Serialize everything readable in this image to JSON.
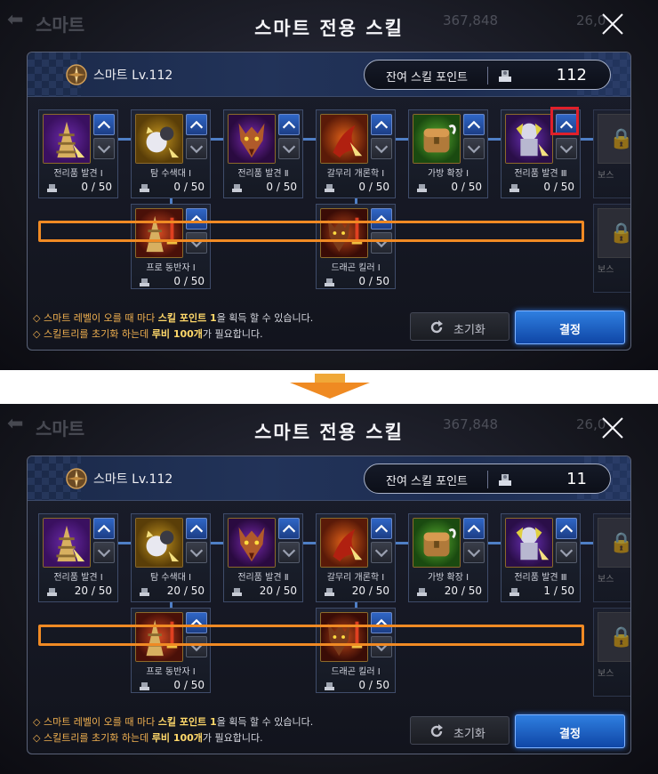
{
  "ghost": {
    "back": "⬅",
    "title": "스마트",
    "num1": "367,848",
    "num2": "26,0"
  },
  "dialog": {
    "title": "스마트 전용 스킬",
    "close_icon": "close-icon"
  },
  "info": {
    "character": "스마트 Lv.112",
    "points_label": "잔여 스킬 포인트"
  },
  "screens": [
    {
      "points_value": "112",
      "skills_top": [
        {
          "name": "전리품 발견 Ⅰ",
          "points": "0 / 50",
          "icon": "bell-tower-icon"
        },
        {
          "name": "탐 수색대 Ⅰ",
          "points": "0 / 50",
          "icon": "loot-bag-icon"
        },
        {
          "name": "전리품 발견 Ⅱ",
          "points": "0 / 50",
          "icon": "dragon-head-icon"
        },
        {
          "name": "갈무리 개론학 Ⅰ",
          "points": "0 / 50",
          "icon": "claw-icon"
        },
        {
          "name": "가방 확장 Ⅰ",
          "points": "0 / 50",
          "icon": "backpack-icon"
        },
        {
          "name": "전리품 발견 Ⅲ",
          "points": "0 / 50",
          "icon": "armored-knight-icon"
        }
      ],
      "skills_bottom": [
        {
          "name": "프로 동반자 Ⅰ",
          "points": "0 / 50",
          "icon": "tower-sword-icon"
        },
        {
          "name": "드래곤 킬러 Ⅰ",
          "points": "0 / 50",
          "icon": "dragon-sword-icon"
        }
      ]
    },
    {
      "points_value": "11",
      "skills_top": [
        {
          "name": "전리품 발견 Ⅰ",
          "points": "20 / 50",
          "icon": "bell-tower-icon"
        },
        {
          "name": "탐 수색대 Ⅰ",
          "points": "20 / 50",
          "icon": "loot-bag-icon"
        },
        {
          "name": "전리품 발견 Ⅱ",
          "points": "20 / 50",
          "icon": "dragon-head-icon"
        },
        {
          "name": "갈무리 개론학 Ⅰ",
          "points": "20 / 50",
          "icon": "claw-icon"
        },
        {
          "name": "가방 확장 Ⅰ",
          "points": "20 / 50",
          "icon": "backpack-icon"
        },
        {
          "name": "전리품 발견 Ⅲ",
          "points": "1 / 50",
          "icon": "armored-knight-icon"
        }
      ],
      "skills_bottom": [
        {
          "name": "프로 동반자 Ⅰ",
          "points": "0 / 50",
          "icon": "tower-sword-icon"
        },
        {
          "name": "드래곤 킬러 Ⅰ",
          "points": "0 / 50",
          "icon": "dragon-sword-icon"
        }
      ]
    }
  ],
  "locked_skill": {
    "name": "보스",
    "icon": "lock-icon"
  },
  "notes": {
    "line1_a": "◇ 스마트 레벨이 오를 때 마다 ",
    "line1_hl": "스킬 포인트 1",
    "line1_b": "을 획득 할 수 있습니다.",
    "line2_a": "◇ 스킬트리를 초기화 하는데 ",
    "line2_hl": "루비 100개",
    "line2_b": "가 필요합니다."
  },
  "buttons": {
    "reset": "초기화",
    "confirm": "결정"
  },
  "colors": {
    "highlight_orange": "#f08a24",
    "highlight_red": "#e0202a",
    "accent_blue": "#2f7fe0"
  }
}
